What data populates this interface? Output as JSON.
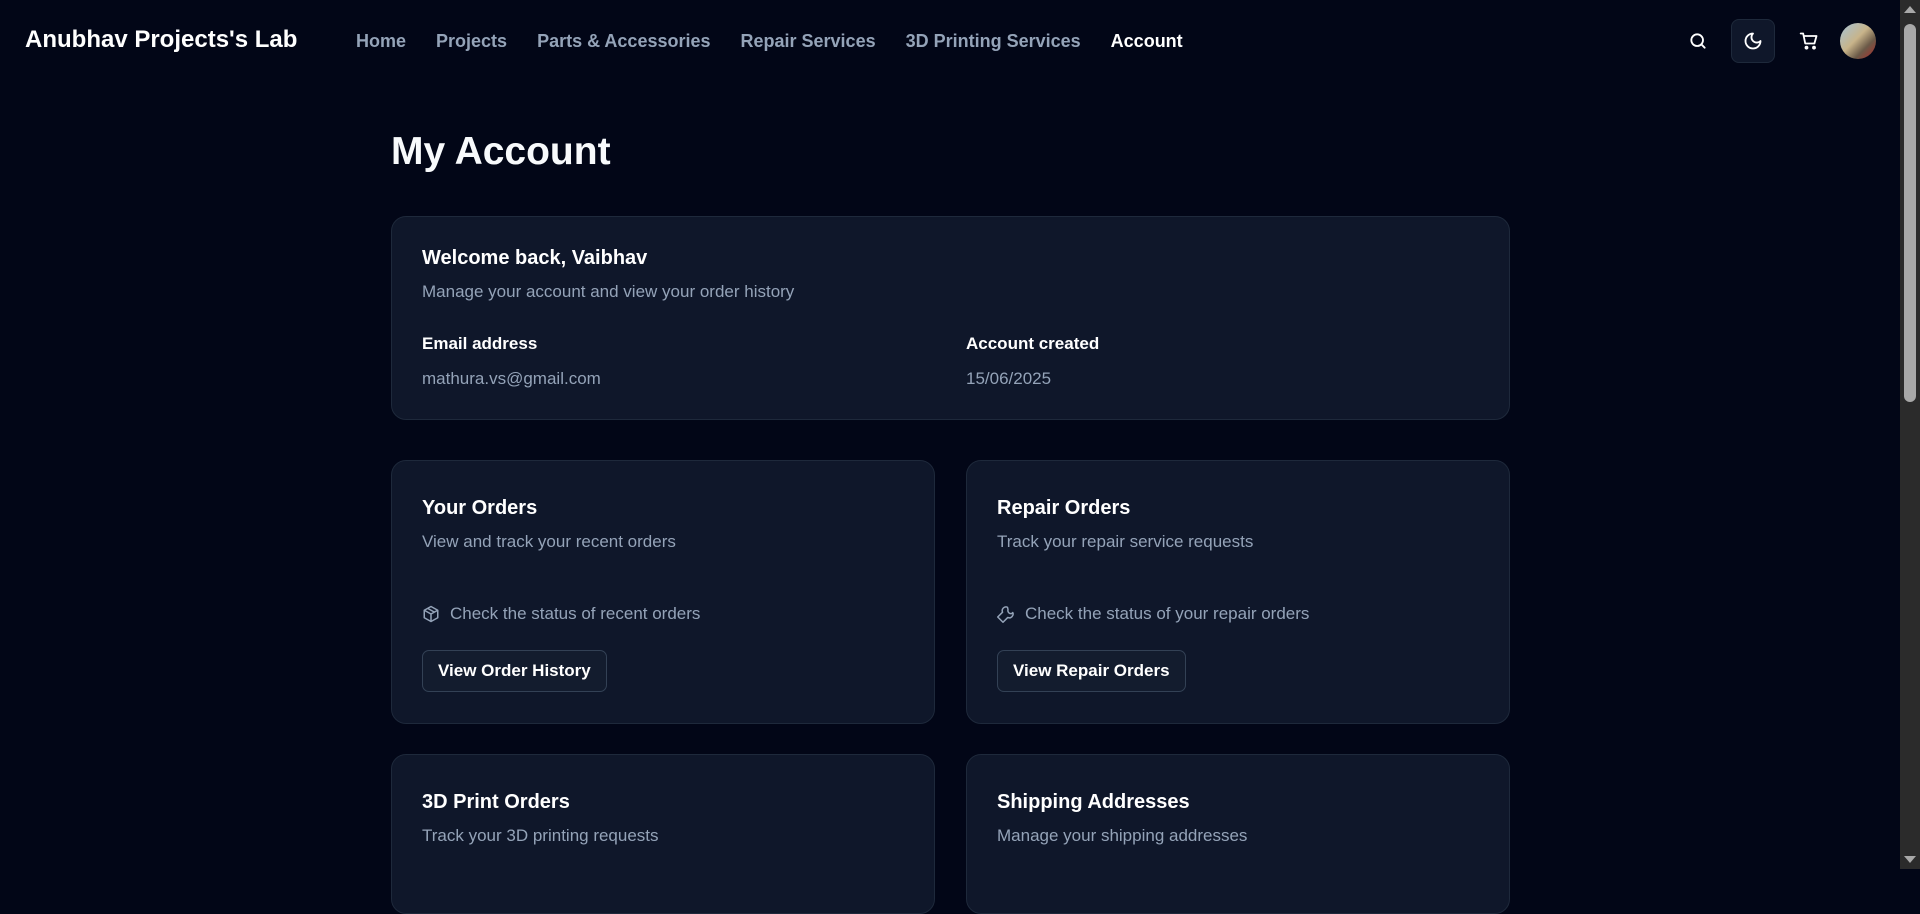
{
  "header": {
    "brand": "Anubhav Projects's Lab",
    "nav": [
      "Home",
      "Projects",
      "Parts & Accessories",
      "Repair Services",
      "3D Printing Services",
      "Account"
    ],
    "active": "Account"
  },
  "page_title": "My Account",
  "welcome": {
    "title": "Welcome back, Vaibhav",
    "subtitle": "Manage your account and view your order history",
    "email_label": "Email address",
    "email": "mathura.vs@gmail.com",
    "created_label": "Account created",
    "created": "15/06/2025"
  },
  "cards": [
    {
      "title": "Your Orders",
      "subtitle": "View and track your recent orders",
      "feature": "Check the status of recent orders",
      "icon": "package-icon",
      "button": "View Order History"
    },
    {
      "title": "Repair Orders",
      "subtitle": "Track your repair service requests",
      "feature": "Check the status of your repair orders",
      "icon": "wrench-icon",
      "button": "View Repair Orders"
    },
    {
      "title": "3D Print Orders",
      "subtitle": "Track your 3D printing requests"
    },
    {
      "title": "Shipping Addresses",
      "subtitle": "Manage your shipping addresses"
    }
  ]
}
